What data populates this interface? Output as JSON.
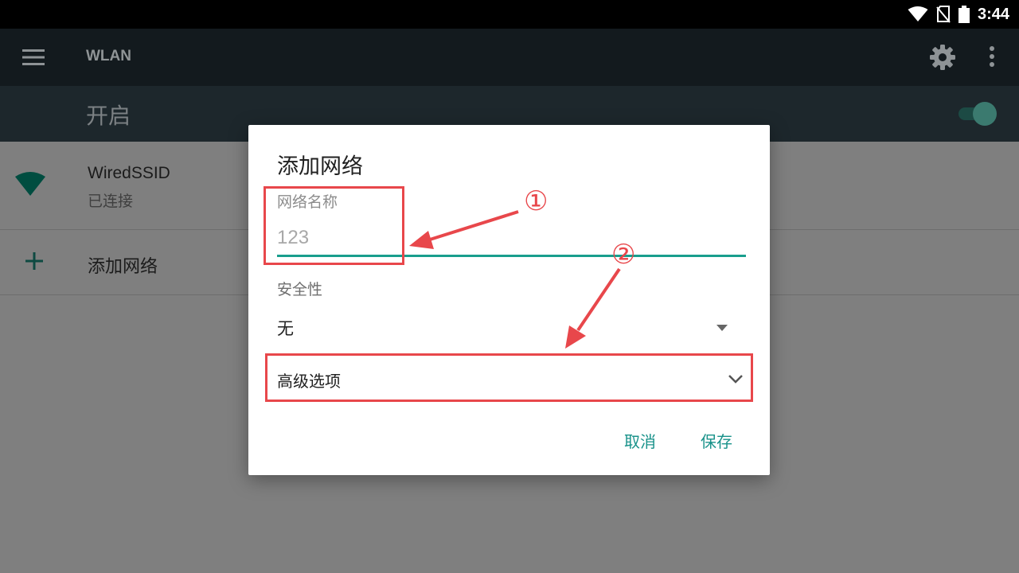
{
  "status_bar": {
    "time": "3:44",
    "icons": [
      "wifi-full-icon",
      "sim-none-icon",
      "battery-icon"
    ]
  },
  "toolbar": {
    "title": "WLAN",
    "icons": [
      "menu-icon",
      "gear-icon",
      "more-vert-icon"
    ]
  },
  "switch_bar": {
    "label": "开启",
    "enabled": true
  },
  "networks": [
    {
      "ssid": "WiredSSID",
      "status": "已连接",
      "icon": "wifi-signal-icon"
    }
  ],
  "add_network_row": {
    "label": "添加网络",
    "icon": "plus-icon"
  },
  "dialog": {
    "title": "添加网络",
    "ssid_label": "网络名称",
    "ssid_value": "123",
    "security_label": "安全性",
    "security_value": "无",
    "advanced_label": "高级选项",
    "cancel_label": "取消",
    "save_label": "保存"
  },
  "annotations": {
    "marker_1": "①",
    "marker_2": "②"
  },
  "colors": {
    "accent": "#199e8d",
    "annotation": "#e8474b",
    "toolbar": "#131a1e"
  }
}
